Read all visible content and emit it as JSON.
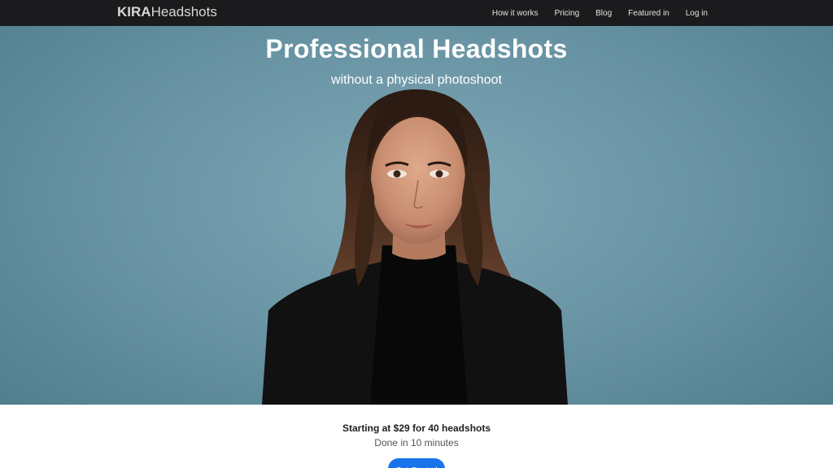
{
  "nav": {
    "brand_bold": "KIRA",
    "brand_light": "Headshots",
    "links": [
      "How it works",
      "Pricing",
      "Blog",
      "Featured in",
      "Log in"
    ]
  },
  "hero": {
    "title": "Professional Headshots",
    "subtitle": "without a physical photoshoot"
  },
  "offer": {
    "pricing": "Starting at $29 for 40 headshots",
    "time": "Done in 10 minutes",
    "cta_label": "Get Started"
  },
  "colors": {
    "nav_bg": "#1b1b1d",
    "hero_bg": "#6b96a6",
    "cta": "#1a73e8"
  }
}
